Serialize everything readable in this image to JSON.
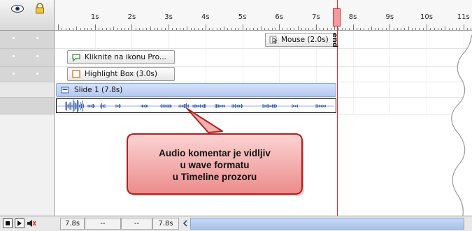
{
  "ruler": {
    "labels": [
      "1s",
      "2s",
      "3s",
      "4s",
      "5s",
      "6s",
      "7s",
      "8s",
      "9s",
      "10s",
      "11s"
    ]
  },
  "tracks": [
    {
      "label": "Mouse (2.0s)",
      "icon": "mouse-icon"
    },
    {
      "label": "Kliknite na ikonu Pro...",
      "icon": "caption-icon"
    },
    {
      "label": "Highlight Box (3.0s)",
      "icon": "highlight-box-icon"
    },
    {
      "label": "Slide 1 (7.8s)",
      "icon": "slide-icon"
    }
  ],
  "playhead": {
    "end_label": "end"
  },
  "callout": {
    "line1": "Audio komentar je vidljiv",
    "line2": "u wave formatu",
    "line3": "u Timeline prozoru"
  },
  "bottom_bar": {
    "cells": [
      "7.8s",
      "--",
      "--",
      "7.8s"
    ]
  },
  "colors": {
    "accent_red": "#e0282c",
    "slide_blue": "#b8cdf6",
    "callout_fill": "#f19a9a"
  }
}
